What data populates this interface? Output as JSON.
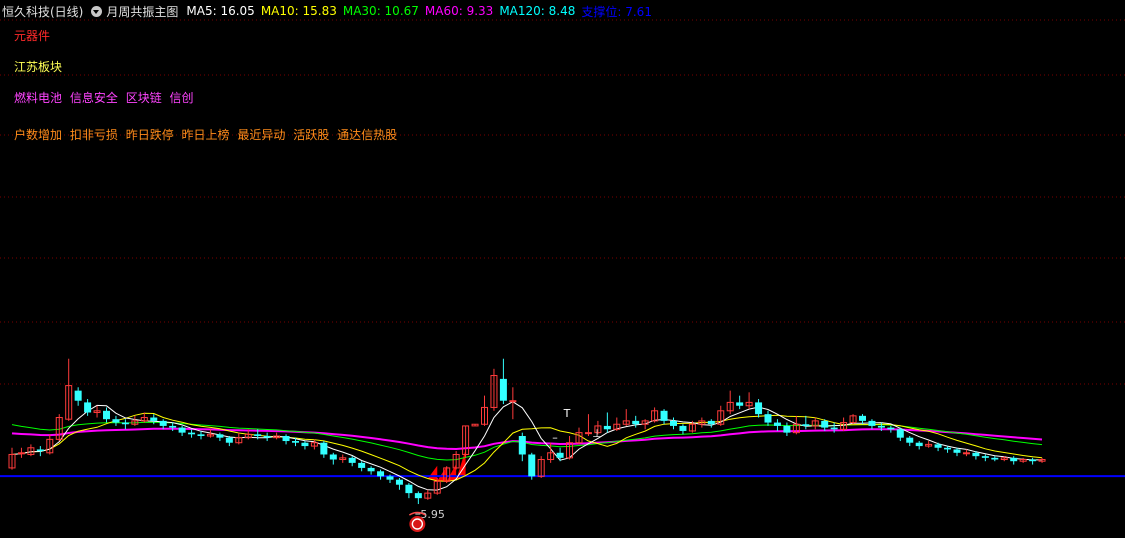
{
  "header": {
    "stock": "恒久科技(日线)",
    "indicator": "月周共振主图",
    "ma": [
      {
        "label": "MA5: 16.05",
        "color": "#ffffff"
      },
      {
        "label": "MA10: 15.83",
        "color": "#ffff00"
      },
      {
        "label": "MA30: 10.67",
        "color": "#00ff00"
      },
      {
        "label": "MA60: 9.33",
        "color": "#ff00ff"
      },
      {
        "label": "MA120: 8.48",
        "color": "#00ffff"
      },
      {
        "label": "支撑位: 7.61",
        "color": "#0000ff"
      }
    ]
  },
  "tags": {
    "line1": {
      "color": "#ff2a2a",
      "items": [
        "元器件"
      ]
    },
    "line2": {
      "color": "#ffff55",
      "items": [
        "江苏板块"
      ]
    },
    "line3": {
      "color": "#ff44ff",
      "items": [
        "燃料电池",
        "信息安全",
        "区块链",
        "信创"
      ]
    },
    "line4": {
      "color": "#ff8c1a",
      "items": [
        "户数增加",
        "扣非亏损",
        "昨日跌停",
        "昨日上榜",
        "最近异动",
        "活跃股",
        "通达信热股"
      ]
    }
  },
  "chart_data": {
    "type": "candlestick",
    "low_label": "5.95",
    "low_marker_icon": "signal-marker-icon",
    "colors": {
      "up": "#ff3b3b",
      "down": "#33ffff",
      "grid": "#7a0000",
      "ma5": "#ffffff",
      "ma10": "#ffff00",
      "ma30": "#00ff00",
      "ma60": "#ff00ff",
      "support": "#0000ff"
    },
    "support_price": 7.61,
    "candles": [
      [
        8.1,
        8.9,
        9.3,
        8.0
      ],
      [
        9.0,
        9.0,
        9.3,
        8.7
      ],
      [
        8.9,
        9.3,
        9.5,
        8.8
      ],
      [
        9.2,
        9.1,
        9.4,
        8.8
      ],
      [
        9.0,
        9.8,
        10.1,
        8.9
      ],
      [
        9.8,
        11.1,
        11.3,
        9.7
      ],
      [
        11.0,
        13.0,
        14.6,
        10.9
      ],
      [
        12.7,
        12.1,
        12.9,
        11.8
      ],
      [
        12.0,
        11.4,
        12.2,
        11.2
      ],
      [
        11.4,
        11.5,
        11.8,
        11.1
      ],
      [
        11.5,
        11.0,
        11.7,
        10.8
      ],
      [
        11.0,
        10.8,
        11.2,
        10.6
      ],
      [
        10.8,
        10.7,
        11.0,
        10.4
      ],
      [
        10.7,
        10.9,
        11.2,
        10.6
      ],
      [
        10.9,
        11.1,
        11.4,
        10.8
      ],
      [
        11.1,
        10.9,
        11.3,
        10.7
      ],
      [
        10.9,
        10.6,
        11.0,
        10.4
      ],
      [
        10.6,
        10.5,
        10.8,
        10.3
      ],
      [
        10.5,
        10.2,
        10.6,
        10.0
      ],
      [
        10.2,
        10.1,
        10.4,
        9.9
      ],
      [
        10.1,
        10.0,
        10.3,
        9.8
      ],
      [
        10.0,
        10.1,
        10.4,
        9.9
      ],
      [
        10.1,
        9.9,
        10.2,
        9.7
      ],
      [
        9.9,
        9.6,
        10.0,
        9.4
      ],
      [
        9.6,
        9.9,
        10.2,
        9.5
      ],
      [
        9.9,
        10.1,
        10.4,
        9.8
      ],
      [
        10.1,
        10.0,
        10.4,
        9.8
      ],
      [
        10.0,
        9.9,
        10.2,
        9.7
      ],
      [
        9.9,
        10.0,
        10.2,
        9.8
      ],
      [
        10.0,
        9.7,
        10.1,
        9.5
      ],
      [
        9.7,
        9.6,
        9.9,
        9.4
      ],
      [
        9.6,
        9.4,
        9.7,
        9.2
      ],
      [
        9.4,
        9.6,
        9.8,
        9.2
      ],
      [
        9.6,
        8.9,
        9.7,
        8.7
      ],
      [
        8.9,
        8.6,
        9.0,
        8.3
      ],
      [
        8.6,
        8.7,
        8.9,
        8.4
      ],
      [
        8.7,
        8.4,
        8.8,
        8.2
      ],
      [
        8.4,
        8.1,
        8.5,
        7.9
      ],
      [
        8.1,
        7.9,
        8.2,
        7.7
      ],
      [
        7.9,
        7.6,
        8.0,
        7.4
      ],
      [
        7.6,
        7.4,
        7.7,
        7.2
      ],
      [
        7.4,
        7.1,
        7.5,
        6.8
      ],
      [
        7.1,
        6.6,
        7.2,
        6.3
      ],
      [
        6.6,
        6.3,
        6.7,
        5.95
      ],
      [
        6.3,
        6.6,
        6.8,
        6.2
      ],
      [
        6.6,
        7.3,
        7.5,
        6.5
      ],
      [
        7.3,
        8.1,
        8.2,
        7.2
      ],
      [
        8.1,
        8.9,
        9.1,
        8.0
      ],
      [
        8.9,
        10.6,
        10.6,
        8.7
      ],
      [
        10.6,
        10.7,
        10.7,
        10.6
      ],
      [
        10.7,
        11.7,
        12.4,
        10.6
      ],
      [
        11.7,
        13.6,
        14.0,
        11.5
      ],
      [
        13.4,
        12.1,
        14.6,
        11.9
      ],
      [
        12.1,
        12.1,
        12.9,
        11.0
      ],
      [
        10.0,
        8.9,
        10.2,
        8.5
      ],
      [
        8.9,
        7.6,
        9.0,
        7.4
      ],
      [
        7.6,
        8.6,
        8.8,
        7.5
      ],
      [
        8.6,
        9.0,
        9.6,
        8.4
      ],
      [
        9.0,
        8.7,
        9.3,
        8.5
      ],
      [
        8.7,
        9.6,
        10.0,
        8.6
      ],
      [
        9.6,
        10.2,
        10.5,
        9.5
      ],
      [
        10.2,
        10.2,
        11.3,
        10.0
      ],
      [
        10.2,
        10.6,
        10.9,
        10.1
      ],
      [
        10.6,
        10.4,
        11.4,
        10.2
      ],
      [
        10.4,
        10.7,
        11.1,
        10.3
      ],
      [
        10.7,
        10.9,
        11.6,
        10.6
      ],
      [
        10.9,
        10.7,
        11.2,
        10.5
      ],
      [
        10.7,
        10.9,
        11.0,
        10.4
      ],
      [
        10.9,
        11.5,
        11.7,
        10.8
      ],
      [
        11.5,
        10.9,
        11.6,
        10.7
      ],
      [
        10.9,
        10.6,
        11.1,
        10.4
      ],
      [
        10.6,
        10.3,
        10.7,
        10.1
      ],
      [
        10.3,
        10.7,
        10.9,
        10.2
      ],
      [
        10.7,
        10.9,
        11.1,
        10.5
      ],
      [
        10.9,
        10.7,
        11.0,
        10.5
      ],
      [
        10.7,
        11.5,
        11.8,
        10.6
      ],
      [
        11.5,
        12.0,
        12.7,
        11.3
      ],
      [
        12.0,
        11.8,
        12.4,
        11.6
      ],
      [
        11.8,
        12.0,
        12.6,
        11.6
      ],
      [
        12.0,
        11.3,
        12.2,
        11.1
      ],
      [
        11.3,
        10.8,
        11.5,
        10.6
      ],
      [
        10.8,
        10.6,
        11.0,
        10.3
      ],
      [
        10.6,
        10.2,
        10.8,
        10.0
      ],
      [
        10.2,
        10.7,
        11.2,
        10.1
      ],
      [
        10.7,
        10.6,
        11.2,
        10.4
      ],
      [
        10.6,
        10.9,
        11.1,
        10.4
      ],
      [
        10.9,
        10.5,
        11.0,
        10.3
      ],
      [
        10.5,
        10.4,
        10.8,
        10.2
      ],
      [
        10.4,
        10.8,
        11.1,
        10.3
      ],
      [
        10.8,
        11.2,
        11.3,
        10.7
      ],
      [
        11.2,
        10.9,
        11.3,
        10.7
      ],
      [
        10.9,
        10.6,
        11.0,
        10.4
      ],
      [
        10.6,
        10.5,
        10.8,
        10.3
      ],
      [
        10.5,
        10.4,
        10.6,
        10.2
      ],
      [
        10.4,
        9.9,
        10.5,
        9.7
      ],
      [
        9.9,
        9.6,
        10.0,
        9.4
      ],
      [
        9.6,
        9.4,
        9.7,
        9.2
      ],
      [
        9.4,
        9.5,
        9.7,
        9.3
      ],
      [
        9.5,
        9.3,
        9.6,
        9.1
      ],
      [
        9.3,
        9.2,
        9.4,
        9.0
      ],
      [
        9.2,
        9.0,
        9.3,
        8.8
      ],
      [
        9.0,
        9.0,
        9.2,
        8.8
      ],
      [
        9.0,
        8.8,
        9.1,
        8.6
      ],
      [
        8.8,
        8.7,
        8.9,
        8.5
      ],
      [
        8.7,
        8.6,
        8.8,
        8.5
      ],
      [
        8.6,
        8.7,
        8.8,
        8.5
      ],
      [
        8.7,
        8.5,
        8.8,
        8.3
      ],
      [
        8.5,
        8.6,
        8.7,
        8.4
      ],
      [
        8.6,
        8.5,
        8.7,
        8.3
      ],
      [
        8.5,
        8.6,
        8.7,
        8.4
      ]
    ]
  }
}
